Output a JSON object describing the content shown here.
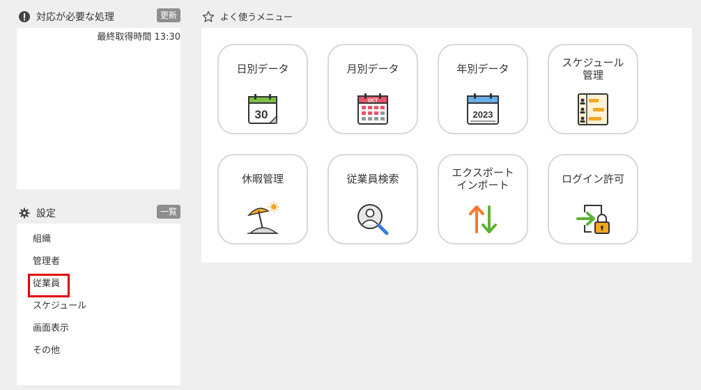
{
  "alerts": {
    "title": "対応が必要な処理",
    "refresh_label": "更新",
    "timestamp": "最終取得時間 13:30"
  },
  "settings": {
    "title": "設定",
    "list_label": "一覧",
    "items": [
      {
        "label": "組織"
      },
      {
        "label": "管理者"
      },
      {
        "label": "従業員"
      },
      {
        "label": "スケジュール"
      },
      {
        "label": "画面表示"
      },
      {
        "label": "その他"
      }
    ]
  },
  "favorites": {
    "title": "よく使うメニュー",
    "tiles": [
      {
        "label": "日別データ",
        "icon": "calendar-day-icon",
        "icon_text": "30"
      },
      {
        "label": "月別データ",
        "icon": "calendar-month-icon",
        "icon_text": "OCT"
      },
      {
        "label": "年別データ",
        "icon": "calendar-year-icon",
        "icon_text": "2023"
      },
      {
        "label": "スケジュール\n管理",
        "icon": "schedule-icon"
      },
      {
        "label": "休暇管理",
        "icon": "vacation-icon"
      },
      {
        "label": "従業員検索",
        "icon": "employee-search-icon"
      },
      {
        "label": "エクスポート\nインポート",
        "icon": "export-import-icon"
      },
      {
        "label": "ログイン許可",
        "icon": "login-permission-icon"
      }
    ]
  },
  "colors": {
    "highlight": "#e00000",
    "calendar_green": "#7bc043",
    "calendar_pink": "#e8546a",
    "calendar_blue": "#6aaee8",
    "accent_orange": "#f5a623"
  }
}
